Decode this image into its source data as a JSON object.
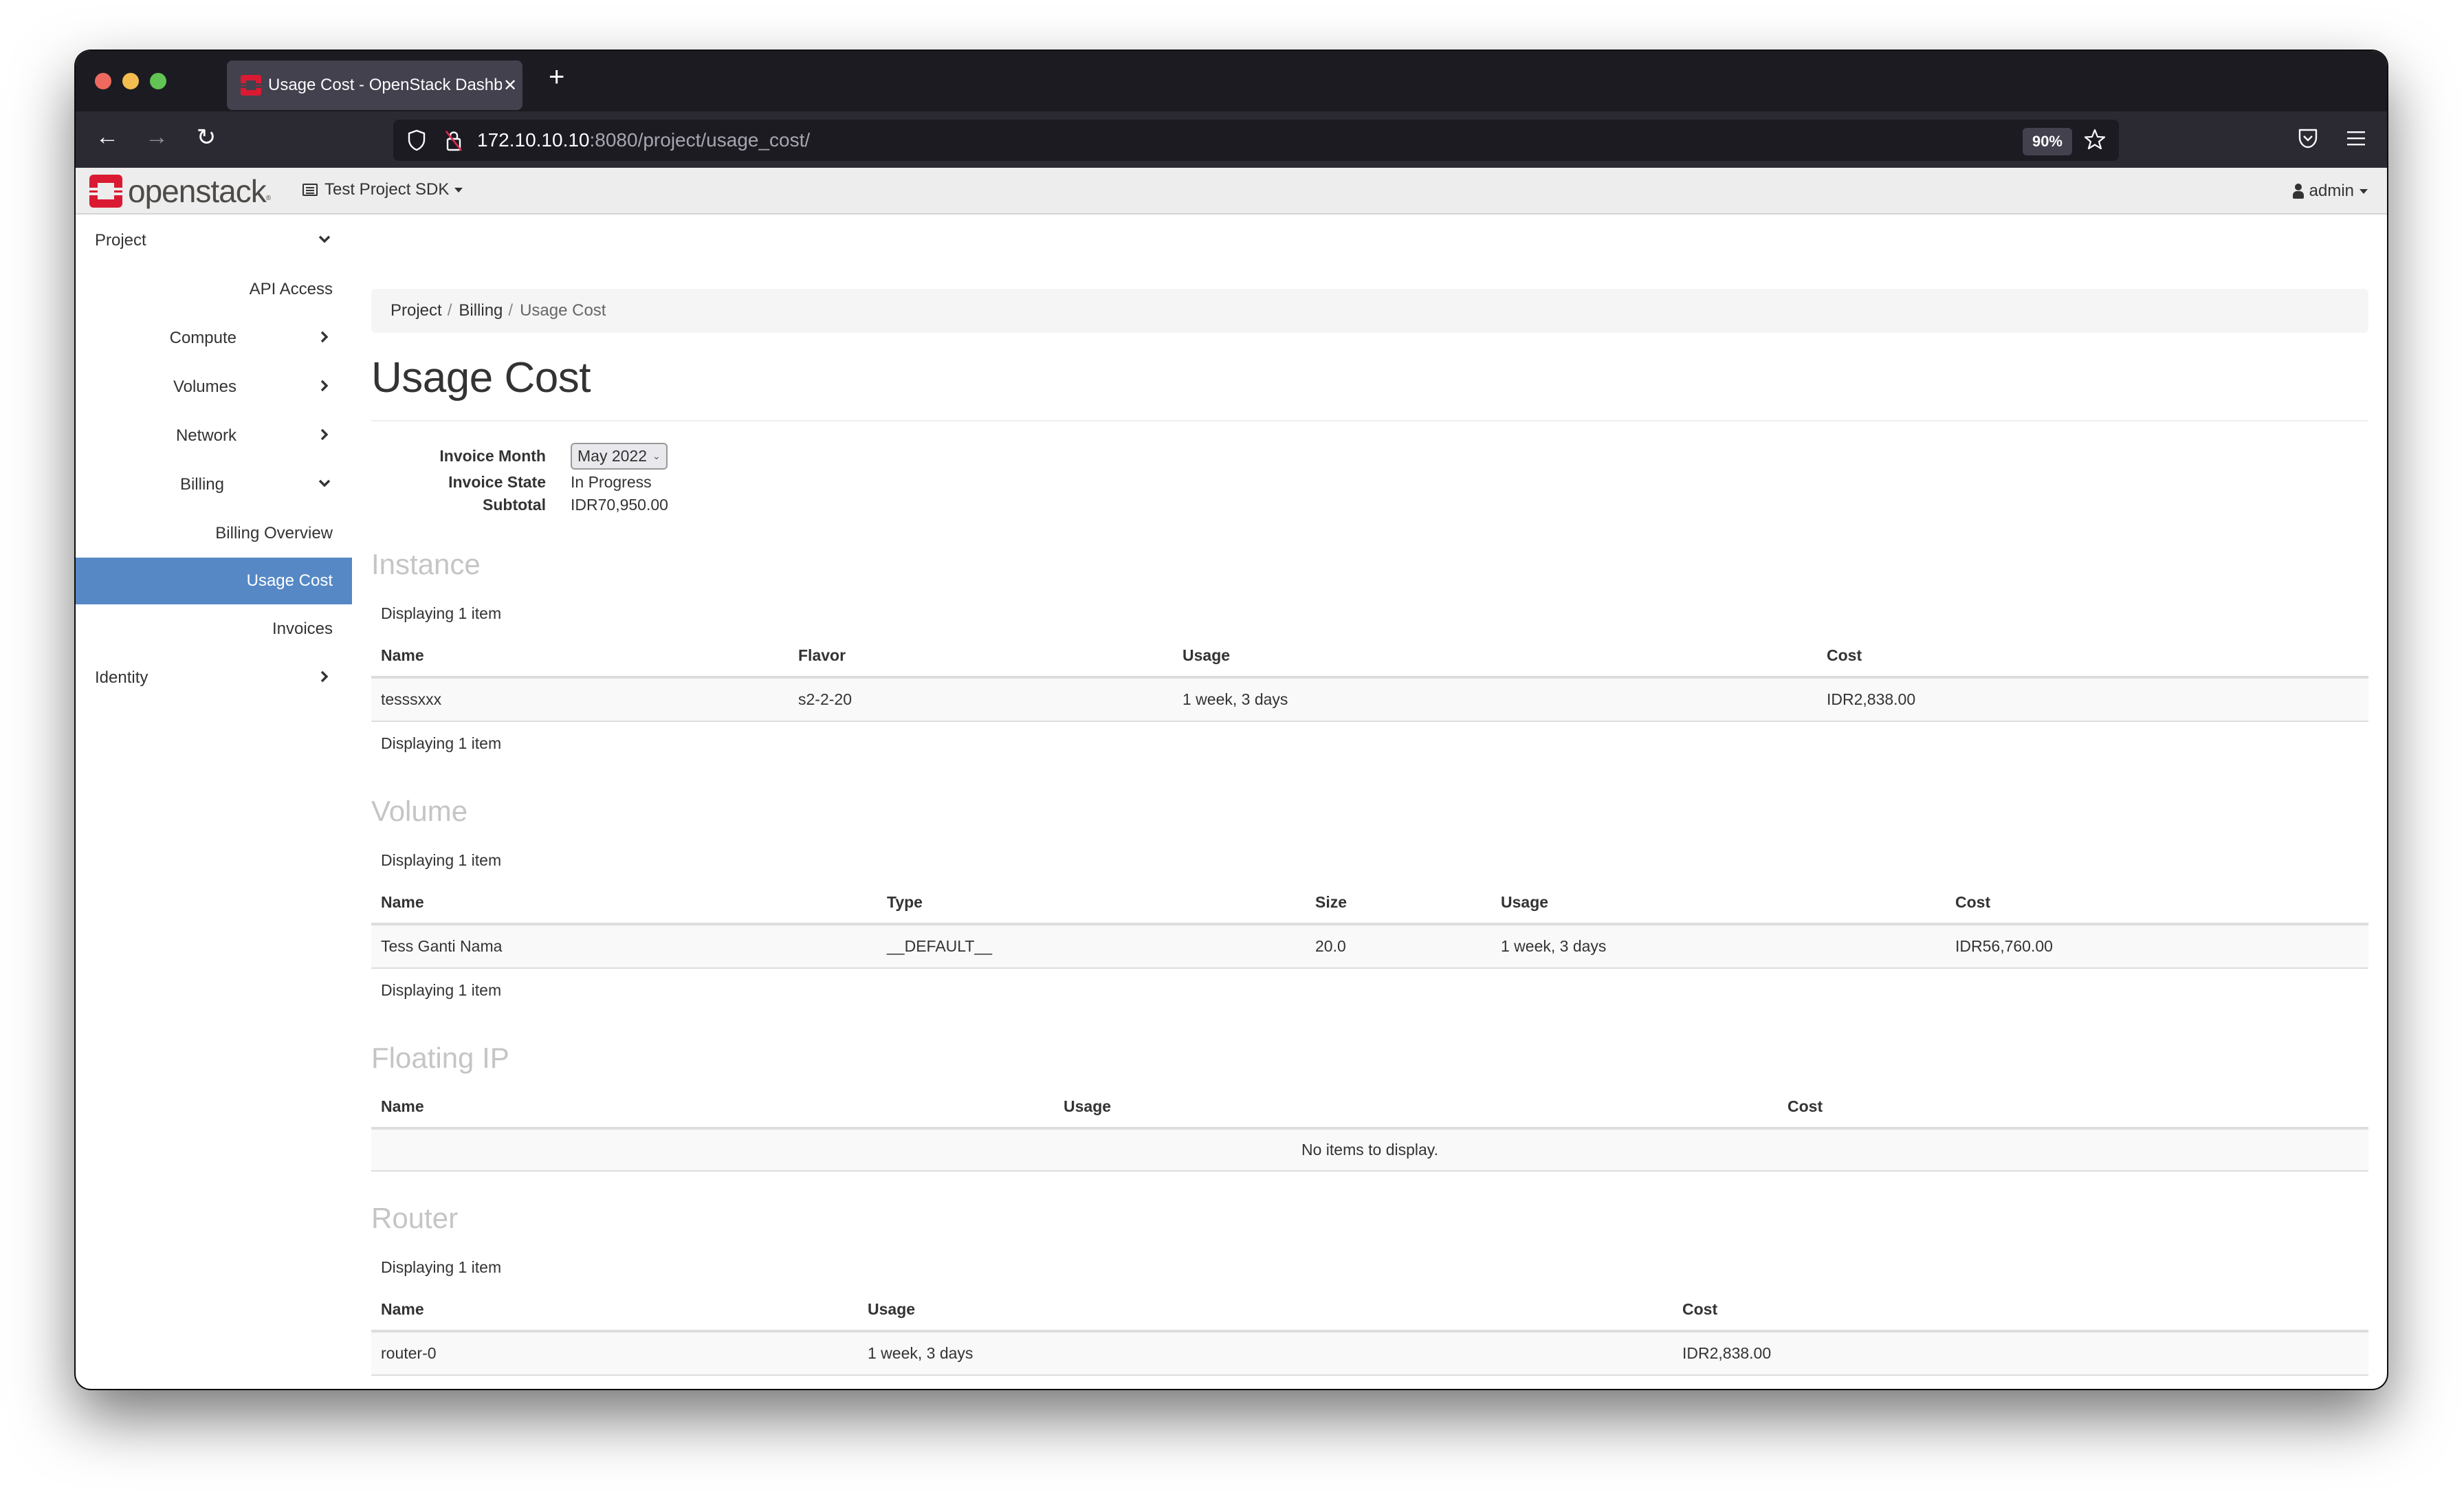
{
  "browser": {
    "tab_title": "Usage Cost - OpenStack Dashboard",
    "url_host": "172.10.10.10",
    "url_rest": ":8080/project/usage_cost/",
    "zoom": "90%"
  },
  "header": {
    "logo_text": "openstack",
    "logo_reg": "®",
    "project": "Test Project SDK",
    "user": "admin"
  },
  "sidebar": {
    "items": [
      {
        "label": "Project",
        "level": "top",
        "chevron": "down"
      },
      {
        "label": "API Access",
        "level": "link"
      },
      {
        "label": "Compute",
        "level": "group",
        "chevron": "right"
      },
      {
        "label": "Volumes",
        "level": "group",
        "chevron": "right"
      },
      {
        "label": "Network",
        "level": "group",
        "chevron": "right"
      },
      {
        "label": "Billing",
        "level": "group",
        "chevron": "down"
      },
      {
        "label": "Billing Overview",
        "level": "link"
      },
      {
        "label": "Usage Cost",
        "level": "link",
        "active": true
      },
      {
        "label": "Invoices",
        "level": "link"
      },
      {
        "label": "Identity",
        "level": "top",
        "chevron": "right"
      }
    ],
    "active_color": "#5688c6"
  },
  "breadcrumb": [
    "Project",
    "Billing",
    "Usage Cost"
  ],
  "page_title": "Usage Cost",
  "summary": {
    "invoice_month_label": "Invoice Month",
    "invoice_month_value": "May 2022",
    "invoice_state_label": "Invoice State",
    "invoice_state_value": "In Progress",
    "subtotal_label": "Subtotal",
    "subtotal_value": "IDR70,950.00"
  },
  "sections": {
    "instance": {
      "title": "Instance",
      "count_text": "Displaying 1 item",
      "columns": [
        "Name",
        "Flavor",
        "Usage",
        "Cost"
      ],
      "rows": [
        [
          "tesssxxx",
          "s2-2-20",
          "1 week, 3 days",
          "IDR2,838.00"
        ]
      ]
    },
    "volume": {
      "title": "Volume",
      "count_text": "Displaying 1 item",
      "columns": [
        "Name",
        "Type",
        "Size",
        "Usage",
        "Cost"
      ],
      "rows": [
        [
          "Tess Ganti Nama",
          "__DEFAULT__",
          "20.0",
          "1 week, 3 days",
          "IDR56,760.00"
        ]
      ]
    },
    "floating_ip": {
      "title": "Floating IP",
      "columns": [
        "Name",
        "Usage",
        "Cost"
      ],
      "empty_text": "No items to display."
    },
    "router": {
      "title": "Router",
      "count_text": "Displaying 1 item",
      "columns": [
        "Name",
        "Usage",
        "Cost"
      ],
      "rows": [
        [
          "router-0",
          "1 week, 3 days",
          "IDR2,838.00"
        ]
      ]
    }
  }
}
